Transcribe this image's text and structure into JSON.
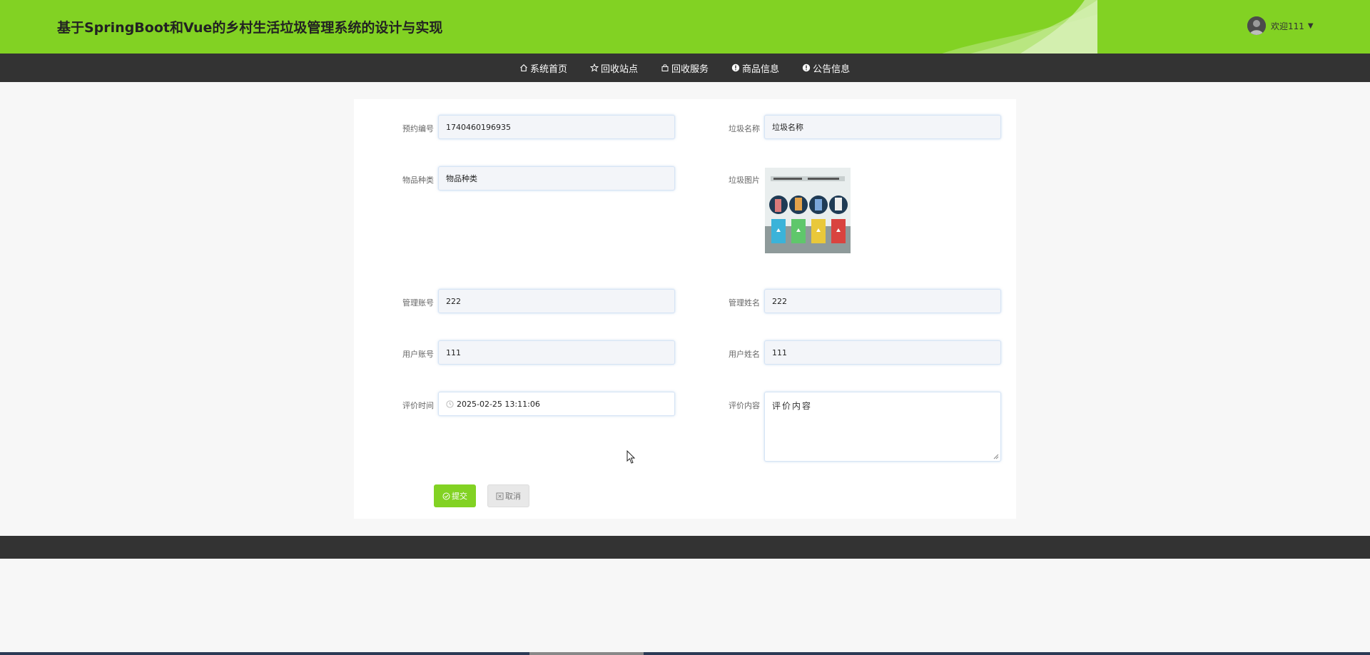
{
  "header": {
    "title": "基于SpringBoot和Vue的乡村生活垃圾管理系统的设计与实现",
    "welcome": "欢迎111",
    "brand_color": "#82d223"
  },
  "nav": {
    "items": [
      {
        "label": "系统首页",
        "icon": "home-icon"
      },
      {
        "label": "回收站点",
        "icon": "star-icon"
      },
      {
        "label": "回收服务",
        "icon": "bag-icon"
      },
      {
        "label": "商品信息",
        "icon": "info-icon"
      },
      {
        "label": "公告信息",
        "icon": "info-icon"
      }
    ]
  },
  "form": {
    "booking_no": {
      "label": "预约编号",
      "value": "1740460196935"
    },
    "garbage_name": {
      "label": "垃圾名称",
      "value": "垃圾名称"
    },
    "item_category": {
      "label": "物品种类",
      "value": "物品种类"
    },
    "garbage_image": {
      "label": "垃圾图片"
    },
    "admin_account": {
      "label": "管理账号",
      "value": "222"
    },
    "admin_name": {
      "label": "管理姓名",
      "value": "222"
    },
    "user_account": {
      "label": "用户账号",
      "value": "111"
    },
    "user_name": {
      "label": "用户姓名",
      "value": "111"
    },
    "review_time": {
      "label": "评价时间",
      "value": "2025-02-25 13:11:06"
    },
    "review_content": {
      "label": "评价内容",
      "value": "评价内容"
    }
  },
  "actions": {
    "submit": "提交",
    "cancel": "取消"
  }
}
